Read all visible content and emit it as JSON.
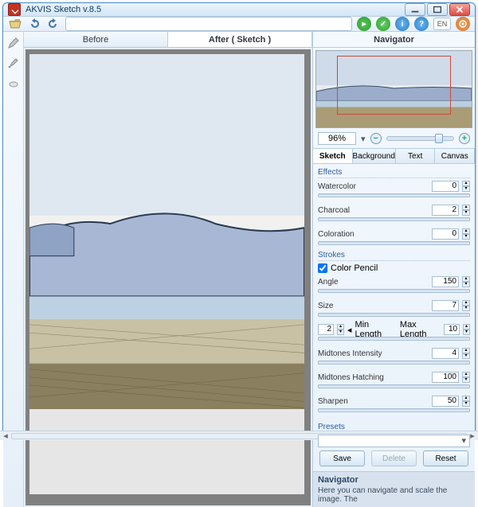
{
  "window": {
    "title": "AKVIS Sketch v.8.5"
  },
  "toolbar": {
    "lang": "EN"
  },
  "tabs": {
    "before": "Before",
    "after": "After ( Sketch )"
  },
  "navigator": {
    "heading": "Navigator"
  },
  "zoom": {
    "value": "96%"
  },
  "stabs": {
    "sketch": "Sketch",
    "background": "Background",
    "text": "Text",
    "canvas": "Canvas"
  },
  "groups": {
    "effects": "Effects",
    "strokes": "Strokes",
    "presets": "Presets"
  },
  "params": {
    "watercolor": {
      "label": "Watercolor",
      "value": "0"
    },
    "charcoal": {
      "label": "Charcoal",
      "value": "2"
    },
    "coloration": {
      "label": "Coloration",
      "value": "0"
    },
    "colorpencil": {
      "label": "Color Pencil"
    },
    "angle": {
      "label": "Angle",
      "value": "150"
    },
    "size": {
      "label": "Size",
      "value": "7"
    },
    "minlen": {
      "value": "2",
      "label": "Min Length"
    },
    "maxlen": {
      "label": "Max Length",
      "value": "10"
    },
    "midint": {
      "label": "Midtones Intensity",
      "value": "4"
    },
    "midhatch": {
      "label": "Midtones Hatching",
      "value": "100"
    },
    "sharpen": {
      "label": "Sharpen",
      "value": "50"
    }
  },
  "buttons": {
    "save": "Save",
    "delete": "Delete",
    "reset": "Reset"
  },
  "help": {
    "heading": "Navigator",
    "text": "Here you can navigate and scale the image. The"
  }
}
